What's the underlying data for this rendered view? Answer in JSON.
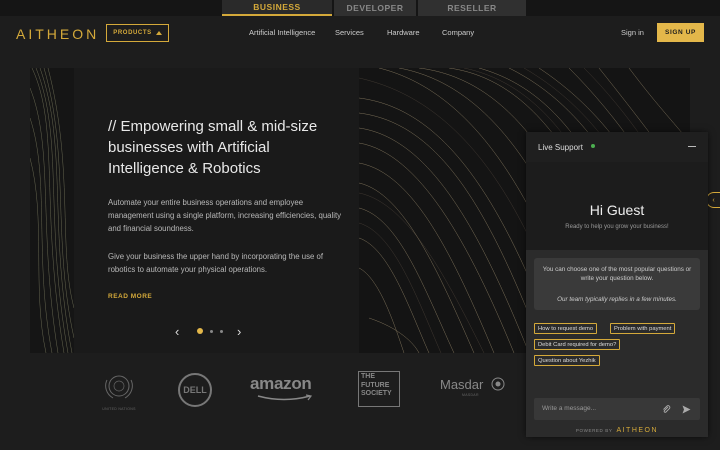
{
  "audience_tabs": [
    "BUSINESS",
    "DEVELOPER",
    "RESELLER"
  ],
  "nav": {
    "logo": "AITHEON",
    "products_label": "PRODUCTS",
    "links": [
      "Artificial Intelligence",
      "Services",
      "Hardware",
      "Company"
    ],
    "sign_in": "Sign in",
    "sign_up": "SIGN UP"
  },
  "hero": {
    "title": "// Empowering small & mid-size businesses with Artificial Intelligence & Robotics",
    "paragraph1": "Automate your entire business operations and employee management using a single platform, increasing efficiencies, quality and financial soundness.",
    "paragraph2": "Give your business the upper hand by incorporating the use of robotics to automate your physical operations.",
    "read_more": "READ MORE",
    "carousel_active": 1,
    "carousel_total": 3
  },
  "partners": {
    "un_caption": "UNITED NATIONS",
    "dell": "DELL",
    "amazon": "amazon",
    "future_society": [
      "THE",
      "FUTURE",
      "SOCIETY"
    ],
    "masdar": "Masdar",
    "masdar_sub": "MASDAR"
  },
  "chat": {
    "title": "Live Support",
    "greeting": "Hi Guest",
    "subtitle": "Ready to help you grow your business!",
    "message": "You can choose one of the most popular questions or write your question below.",
    "note": "Our team typically replies in a few minutes.",
    "quick_questions": [
      "How to request demo",
      "Problem with payment",
      "Debit Card required for demo?",
      "Question about Yezhik"
    ],
    "input_placeholder": "Write a message...",
    "powered_by": "POWERED BY",
    "powered_logo": "AITHEON"
  },
  "colors": {
    "accent": "#d4a93a",
    "online": "#4caf50"
  }
}
